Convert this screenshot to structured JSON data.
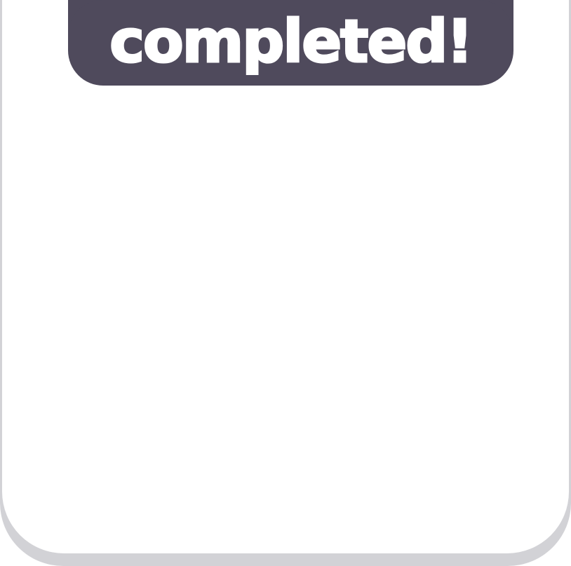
{
  "banner": {
    "label": "completed!"
  },
  "colors": {
    "banner_background": "#4f4a5c",
    "banner_text": "#ffffff",
    "panel_background": "#ffffff",
    "panel_shadow": "#d2d2d6"
  }
}
